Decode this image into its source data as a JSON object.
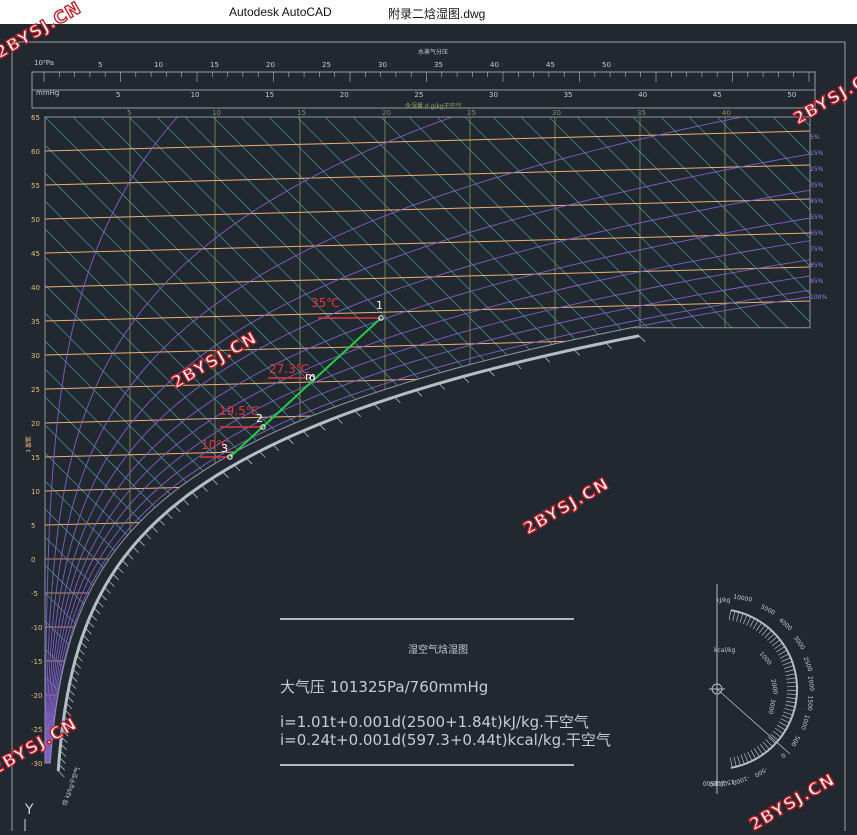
{
  "window": {
    "app_name": "Autodesk AutoCAD",
    "file_name": "附录二焓湿图.dwg"
  },
  "top_scale": {
    "pa_unit": "10³Pa",
    "mmhg_unit": "mmHg",
    "pa_ticks": [
      "5",
      "10",
      "15",
      "20",
      "25",
      "30",
      "35",
      "40",
      "45",
      "50"
    ],
    "mmhg_ticks": [
      "5",
      "10",
      "15",
      "20",
      "25",
      "30",
      "35",
      "40",
      "45",
      "50"
    ],
    "top_label": "水蒸气分压",
    "d_label": "含湿量 d g/kg干空气",
    "d_ticks": [
      "5",
      "10",
      "15",
      "20",
      "25",
      "30",
      "35",
      "40",
      "45"
    ]
  },
  "axis": {
    "temp_label": "温度 t",
    "temp_ticks": [
      "65",
      "60",
      "55",
      "50",
      "45",
      "40",
      "35",
      "30",
      "25",
      "20",
      "15",
      "10",
      "5",
      "0",
      "-5",
      "-10",
      "-15",
      "-20",
      "-25",
      "-30"
    ],
    "rh_labels": [
      "5%",
      "15%",
      "25%",
      "35%",
      "45%",
      "55%",
      "65%",
      "75%",
      "85%",
      "95%",
      "100%"
    ],
    "enthalpy_label": "焓 kJ/kg干空气"
  },
  "points": [
    {
      "id": "1",
      "temp": "35℃"
    },
    {
      "id": "m",
      "temp": "27.3℃"
    },
    {
      "id": "2",
      "temp": "19.5℃"
    },
    {
      "id": "3",
      "temp": "10℃"
    }
  ],
  "info": {
    "title": "湿空气焓湿图",
    "pressure": "大气压  101325Pa/760mmHg",
    "formula_kj": "i=1.01t+0.001d(2500+1.84t)kJ/kg.干空气",
    "formula_kcal": "i=0.24t+0.001d(597.3+0.44t)kcal/kg.干空气"
  },
  "protractor": {
    "unit_kj": "kJ/kg",
    "unit_kcal": "kcal/kg",
    "labels": [
      "10000",
      "5000",
      "4000",
      "3000",
      "2500",
      "2000",
      "1500",
      "1000",
      "500",
      "0",
      "-500",
      "-1000",
      "-1500",
      "-2000",
      "-2500",
      "1000",
      "2000",
      "3000"
    ]
  },
  "ucs": {
    "y_label": "Y"
  },
  "watermark": "2BYSJ.CN",
  "colors": {
    "background": "#212830",
    "grid_green": "#86945a",
    "isotherm_orange": "#f0b070",
    "diagonal_teal": "#3f8a8c",
    "rh_purple": "#8060c8",
    "process_green": "#22cc44",
    "point_label_red": "#e8343c",
    "scale_gray": "#b8bcc4"
  }
}
